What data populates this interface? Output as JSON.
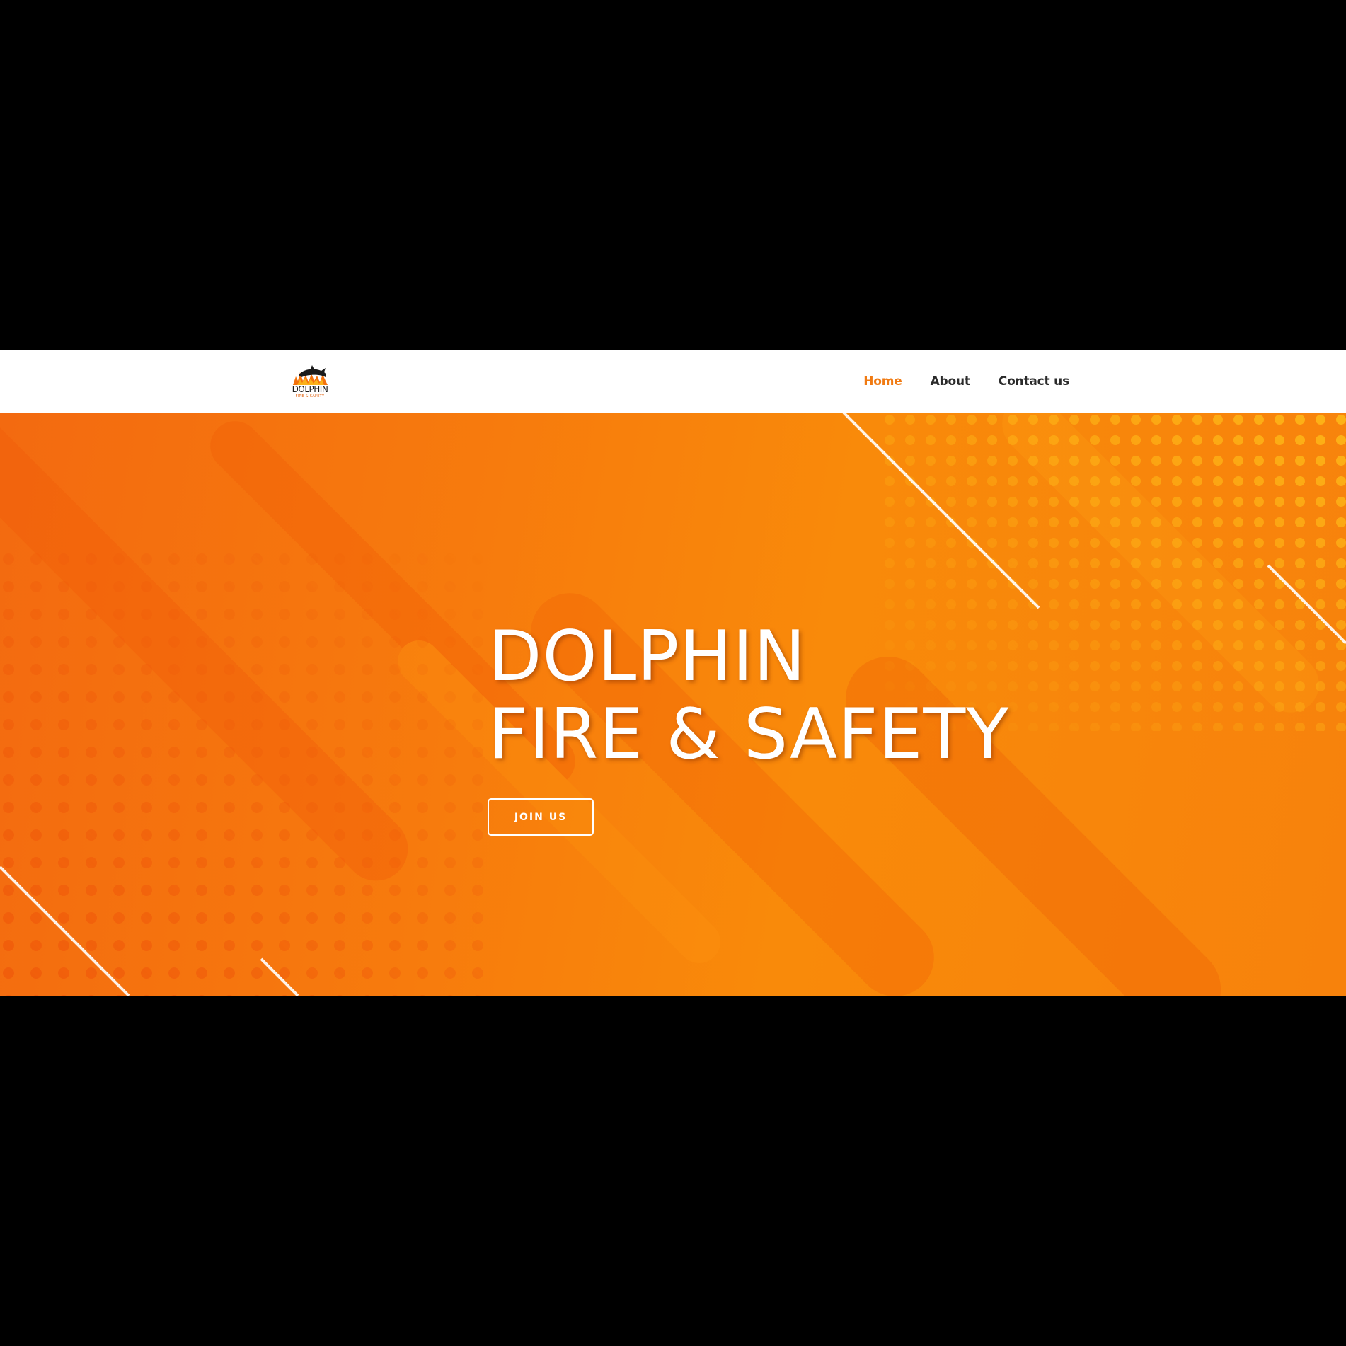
{
  "brand": {
    "logo_name": "DOLPHIN",
    "logo_tagline": "FIRE & SAFETY"
  },
  "nav": {
    "items": [
      {
        "label": "Home",
        "active": true
      },
      {
        "label": "About",
        "active": false
      },
      {
        "label": "Contact us",
        "active": false
      }
    ]
  },
  "hero": {
    "title_line1": "DOLPHIN",
    "title_line2": "FIRE & SAFETY",
    "cta_label": "JOIN US"
  },
  "colors": {
    "accent": "#f07a12",
    "hero_orange": "#f77b0d",
    "nav_text": "#2b2b2b",
    "letterbox": "#000000"
  }
}
